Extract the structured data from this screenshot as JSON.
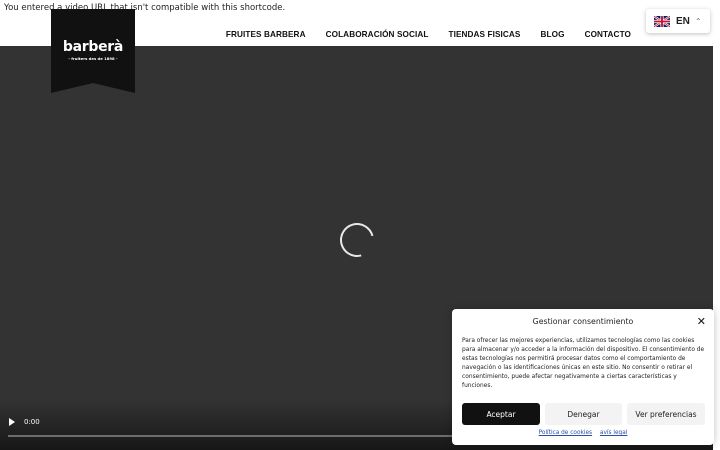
{
  "notice": {
    "text": "You entered a video URL that isn't compatible with this shortcode."
  },
  "logo": {
    "name": "barberà",
    "tagline": "- fruiters des de 1898 -"
  },
  "nav": {
    "items": [
      {
        "label": "FRUITES BARBERA"
      },
      {
        "label": "COLABORACIÓN SOCIAL"
      },
      {
        "label": "TIENDAS FISICAS"
      },
      {
        "label": "BLOG"
      },
      {
        "label": "CONTACTO"
      }
    ]
  },
  "language": {
    "code": "EN",
    "flag": "uk-flag-icon"
  },
  "video": {
    "time": "0:00",
    "progress": 0
  },
  "consent": {
    "title": "Gestionar consentimiento",
    "body": "Para ofrecer las mejores experiencias, utilizamos tecnologías como las cookies para almacenar y/o acceder a la información del dispositivo. El consentimiento de estas tecnologías nos permitirá procesar datos como el comportamiento de navegación o las identificaciones únicas en este sitio. No consentir o retirar el consentimiento, puede afectar negativamente a ciertas características y funciones.",
    "accept_label": "Aceptar",
    "deny_label": "Denegar",
    "prefs_label": "Ver preferencias",
    "cookie_policy_label": "Política de cookies",
    "legal_label": "avís legal"
  },
  "colors": {
    "video_bg": "#333333",
    "accept_bg": "#111111",
    "link": "#2a4fa8"
  }
}
